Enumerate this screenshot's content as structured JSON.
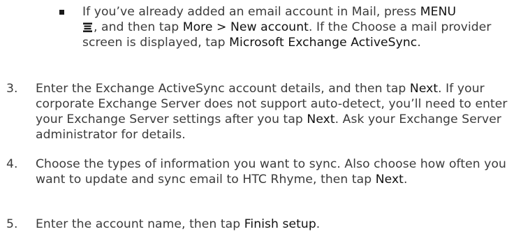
{
  "bullet": {
    "t1": "If you’ve already added an email account in Mail, press ",
    "menu": "MENU",
    "t2": ", and then tap ",
    "more_new": "More > New account",
    "t3": ". If the Choose a mail provider screen is displayed, tap ",
    "exchange": "Microsoft Exchange ActiveSync",
    "t4": "."
  },
  "steps": [
    {
      "number": "3.",
      "t1": "Enter the Exchange ActiveSync account details, and then tap ",
      "next1": "Next",
      "t2": ". If your corporate Exchange Server does not support auto-detect, you’ll need to enter your Exchange Server settings after you tap ",
      "next2": "Next",
      "t3": ". Ask your Exchange Server administrator for details."
    },
    {
      "number": "4.",
      "t1": "Choose the types of information you want to sync. Also choose how often you want to update and sync email to HTC Rhyme, then tap ",
      "next": "Next",
      "t2": "."
    },
    {
      "number": "5.",
      "t1": "Enter the account name, then tap ",
      "finish": "Finish setup",
      "t2": "."
    }
  ],
  "icons": {
    "menu_key": "menu-icon"
  }
}
